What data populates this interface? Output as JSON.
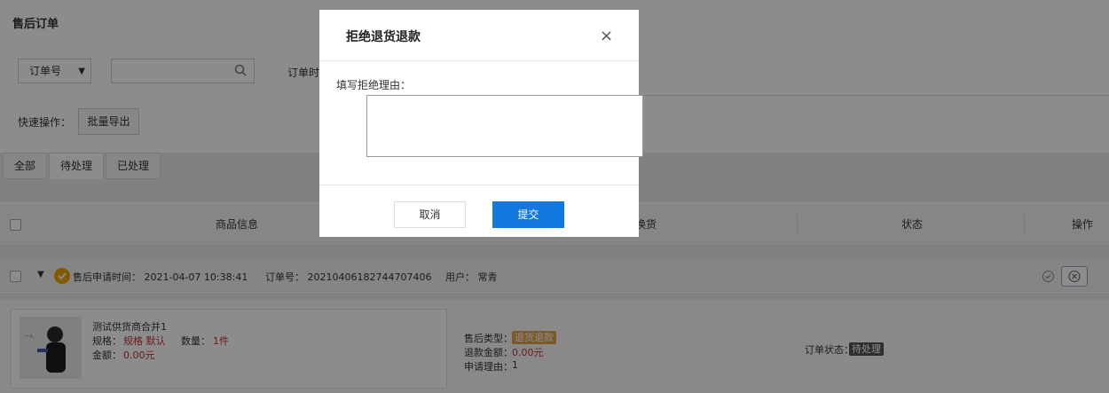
{
  "page": {
    "title": "售后订单",
    "filter_select": "订单号",
    "search_placeholder": "",
    "order_time_label": "订单时",
    "quick_ops_label": "快速操作：",
    "export_button": "批量导出"
  },
  "tabs": [
    {
      "label": "全部"
    },
    {
      "label": "待处理"
    },
    {
      "label": "已处理"
    }
  ],
  "table": {
    "headers": [
      "商品信息",
      "换货",
      "状态",
      "操作"
    ]
  },
  "order": {
    "apply_time": "售后申请时间：  2021-04-07 10:38:41",
    "order_no": "订单号：  20210406182744707406",
    "user": "用户：  常青",
    "product_name": "测试供货商合并1",
    "spec_label": "规格：",
    "spec_value": "规格  默认",
    "qty_label": "数量：",
    "qty_value": "1件",
    "amount_label": "金额：",
    "amount_value": "0.00元",
    "aftersale_type_label": "售后类型：",
    "aftersale_type_value": "退货退款",
    "refund_label": "退款金额：",
    "refund_value": "0.00元",
    "reason_label": "申请理由：",
    "reason_value": "1",
    "order_status_label": "订单状态：",
    "order_status_value": "待处理"
  },
  "modal": {
    "title": "拒绝退货退款",
    "close": "×",
    "reason_label": "填写拒绝理由：",
    "textarea_value": "",
    "cancel": "取消",
    "submit": "提交"
  },
  "colors": {
    "primary": "#1178e0",
    "overlay": "rgba(0,0,0,0.45)",
    "tag_orange": "#e3a24a",
    "price_red": "#c62f2f"
  }
}
